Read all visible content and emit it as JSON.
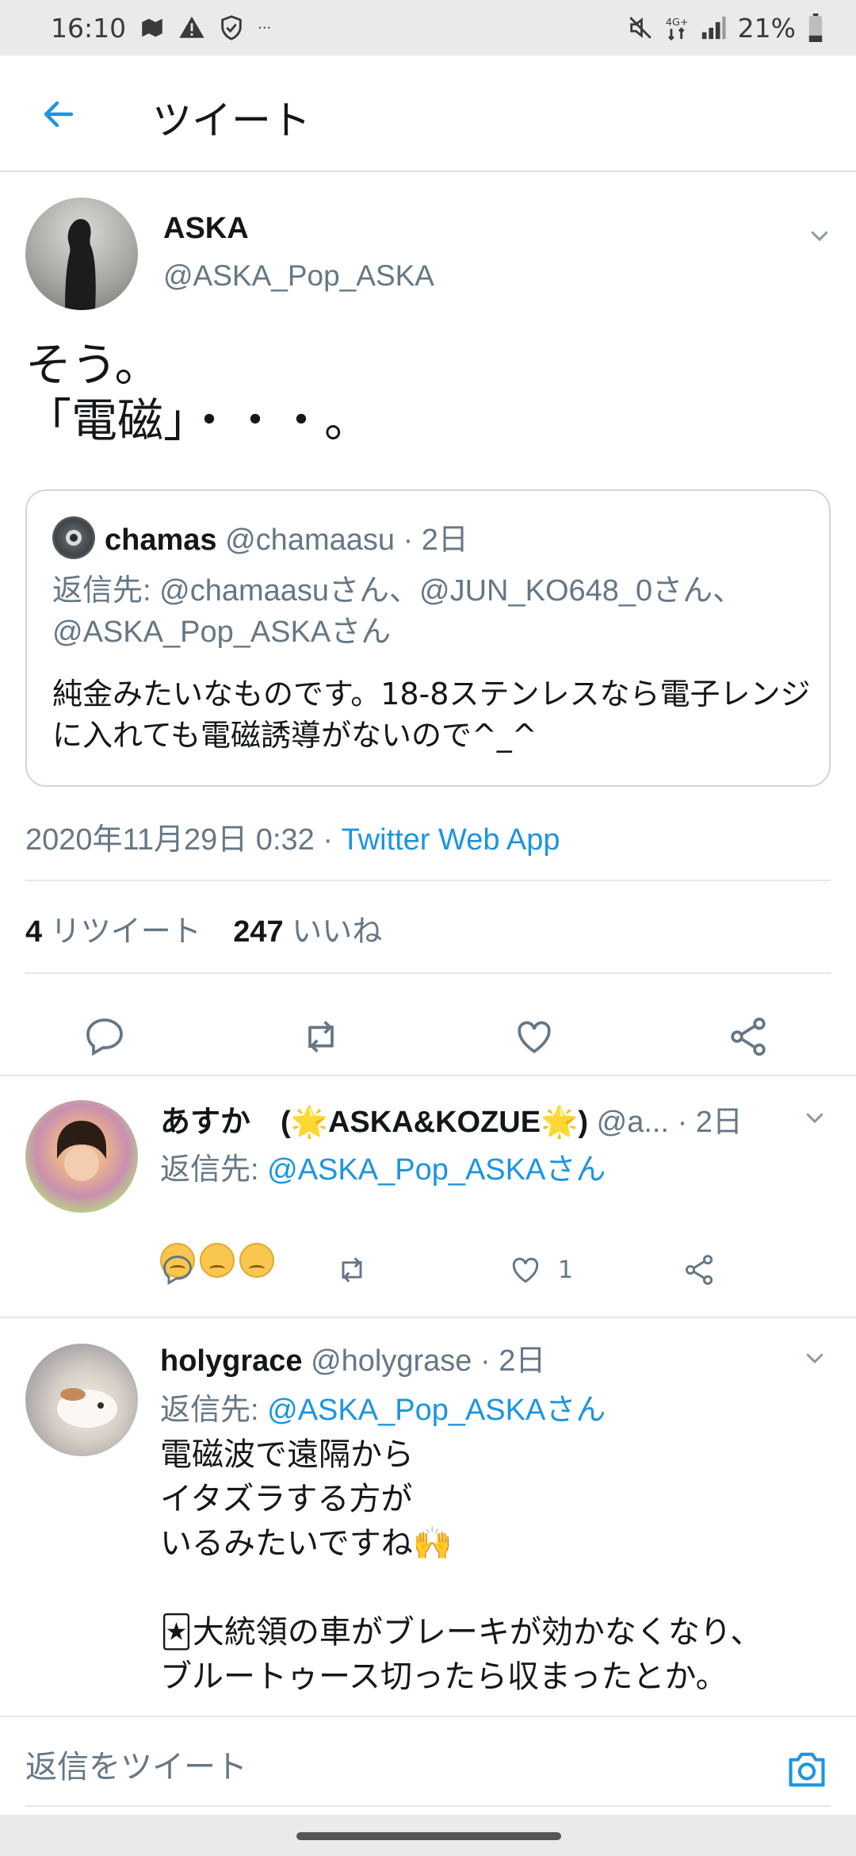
{
  "status_bar": {
    "time": "16:10",
    "left_icons": [
      "map-icon",
      "warning-icon",
      "shield-check-icon",
      "more-icon"
    ],
    "more": "···",
    "battery": "21%",
    "right_icons": [
      "mute-icon",
      "network-4g-icon",
      "signal-icon",
      "battery-icon"
    ]
  },
  "header": {
    "title": "ツイート",
    "back_icon": "back-arrow-icon"
  },
  "tweet": {
    "name": "ASKA",
    "handle": "@ASKA_Pop_ASKA",
    "text": "そう。\n「電磁」・・・。",
    "quote": {
      "name": "chamas",
      "handle": "@chamaasu",
      "time": "2日",
      "reply_to": "返信先: @chamaasuさん、@JUN_KO648_0さん、@ASKA_Pop_ASKAさん",
      "text": "純金みたいなものです。18-8ステンレスなら電子レンジに入れても電磁誘導がないので^_^"
    },
    "timestamp": "2020年11月29日 0:32",
    "via": "Twitter Web App",
    "retweet_count": "4",
    "retweet_label": "リツイート",
    "like_count": "247",
    "like_label": "いいね"
  },
  "replies": [
    {
      "name": "あすか　(🌟ASKA&KOZUE🌟)",
      "handle": "@a...",
      "time": "2日",
      "reply_label": "返信先:",
      "reply_to": "@ASKA_Pop_ASKAさん",
      "emoji_count": 3,
      "emoji": "sad-tear-emoji",
      "like_count": "1"
    },
    {
      "name": "holygrace",
      "handle": "@holygrase",
      "time": "2日",
      "reply_label": "返信先:",
      "reply_to": "@ASKA_Pop_ASKAさん",
      "text": "電磁波で遠隔から\nイタズラする方が\nいるみたいですね🙌\n\n🃏大統領の車がブレーキが効かなくなり、\nブルートゥース切ったら収まったとか。"
    }
  ],
  "composer": {
    "placeholder": "返信をツイート",
    "camera_icon": "camera-icon"
  },
  "colors": {
    "accent": "#1b95e0",
    "secondary_text": "#657786",
    "divider": "#e1e8ed"
  }
}
